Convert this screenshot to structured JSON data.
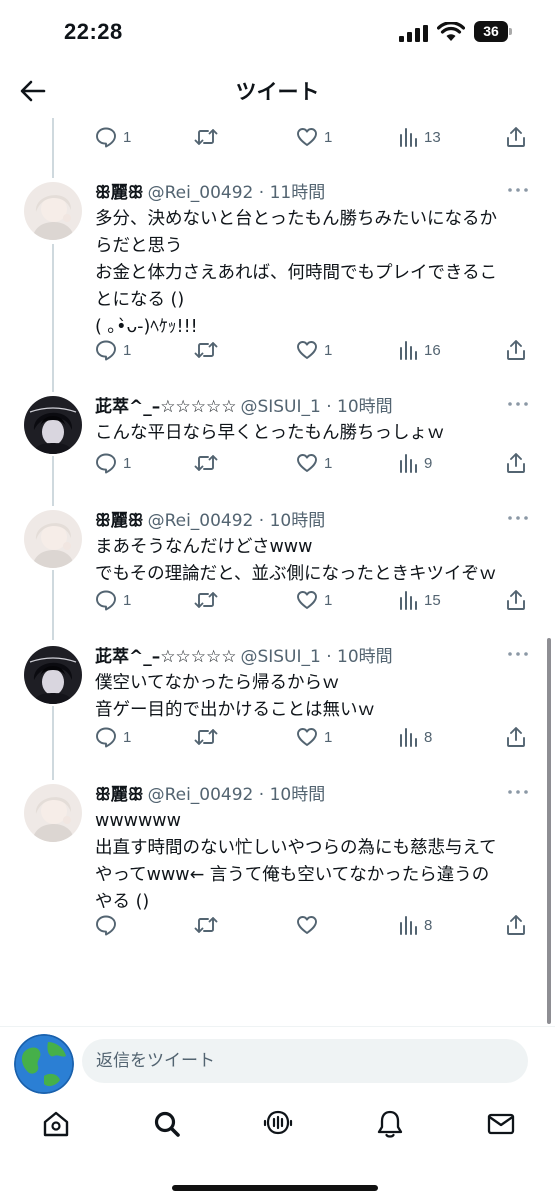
{
  "status_bar": {
    "time": "22:28",
    "battery": "36"
  },
  "header": {
    "title": "ツイート",
    "back_icon": "arrow-left-icon"
  },
  "colors": {
    "text": "#0f1419",
    "secondary": "#536471",
    "thread_line": "#cfd9de"
  },
  "top_actions": {
    "reply": "1",
    "retweet": "",
    "like": "1",
    "views": "13"
  },
  "tweets": [
    {
      "name": "ꕥ麗ꕥ",
      "handle": "@Rei_00492 · 11時間",
      "avatar": "rei",
      "text": "多分、決めないと台とったもん勝ちみたいになるか\nらだと思う\nお金と体力さえあれば、何時間でもプレイできるこ\nとになる ()\n( ｡•̀ᴗ-)ﾍｹｯ!!!",
      "reply": "1",
      "retweet": "",
      "like": "1",
      "views": "16"
    },
    {
      "name": "茈萃^_–☆☆☆☆☆",
      "handle": "@SISUI_1 · 10時間",
      "avatar": "sisui",
      "text": "こんな平日なら早くとったもん勝ちっしょｗ",
      "reply": "1",
      "retweet": "",
      "like": "1",
      "views": "9"
    },
    {
      "name": "ꕥ麗ꕥ",
      "handle": "@Rei_00492 · 10時間",
      "avatar": "rei",
      "text": "まあそうなんだけどさwww\nでもその理論だと、並ぶ側になったときキツイぞｗ",
      "reply": "1",
      "retweet": "",
      "like": "1",
      "views": "15"
    },
    {
      "name": "茈萃^_–☆☆☆☆☆",
      "handle": "@SISUI_1 · 10時間",
      "avatar": "sisui",
      "text": "僕空いてなかったら帰るからｗ\n音ゲー目的で出かけることは無いｗ",
      "reply": "1",
      "retweet": "",
      "like": "1",
      "views": "8"
    },
    {
      "name": "ꕥ麗ꕥ",
      "handle": "@Rei_00492 · 10時間",
      "avatar": "rei",
      "text": "wwwwww\n出直す時間のない忙しいやつらの為にも慈悲与えて\nやってwww← 言うて俺も空いてなかったら違うの\nやる ()",
      "reply": "",
      "retweet": "",
      "like": "",
      "views": "8"
    }
  ],
  "reply_bar": {
    "placeholder": "返信をツイート"
  },
  "tabs": [
    "home-icon",
    "search-icon",
    "spaces-icon",
    "notifications-icon",
    "messages-icon"
  ]
}
